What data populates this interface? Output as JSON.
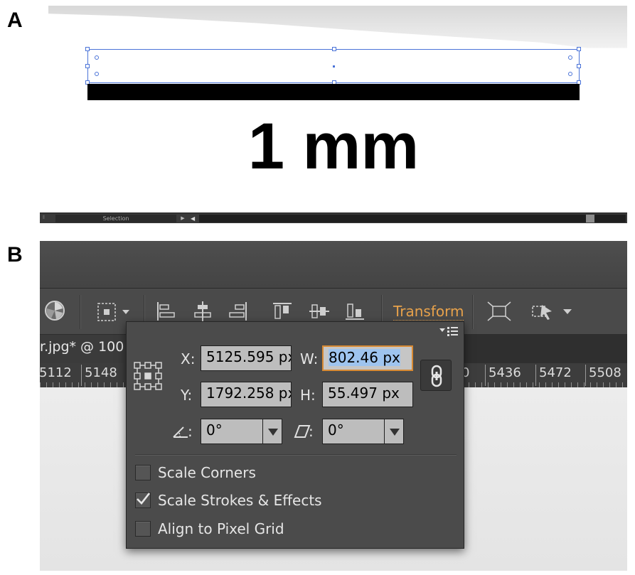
{
  "figure": {
    "panel_a_letter": "A",
    "panel_b_letter": "B"
  },
  "panel_a": {
    "scale_bar_label": "1 mm",
    "status_bar": {
      "tool_name": "Selection"
    }
  },
  "panel_b": {
    "document_tab": "r.jpg* @ 100",
    "ruler_labels": [
      "5112",
      "5148",
      "0",
      "5436",
      "5472",
      "5508"
    ],
    "control_bar": {
      "transform_link": "Transform",
      "icons": [
        "reference-point-icon",
        "align-left-icon",
        "align-horizontal-center-icon",
        "align-right-icon",
        "align-top-icon",
        "align-vertical-center-icon",
        "align-bottom-icon",
        "isolate-object-icon",
        "select-similar-icon"
      ]
    },
    "transform_panel": {
      "x_label": "X:",
      "x_value": "5125.595 px",
      "y_label": "Y:",
      "y_value": "1792.258 px",
      "w_label": "W:",
      "w_value": "802.46 px",
      "h_label": "H:",
      "h_value": "55.497 px",
      "rotate_label": ":",
      "rotate_value": "0°",
      "shear_label": ":",
      "shear_value": "0°",
      "checkboxes": [
        {
          "label": "Scale Corners",
          "checked": false
        },
        {
          "label": "Scale Strokes & Effects",
          "checked": true
        },
        {
          "label": "Align to Pixel Grid",
          "checked": false
        }
      ]
    },
    "colors": {
      "accent": "#e8a24b",
      "selection_highlight": "#9ec4ef",
      "panel_bg": "#4b4b4b"
    }
  }
}
